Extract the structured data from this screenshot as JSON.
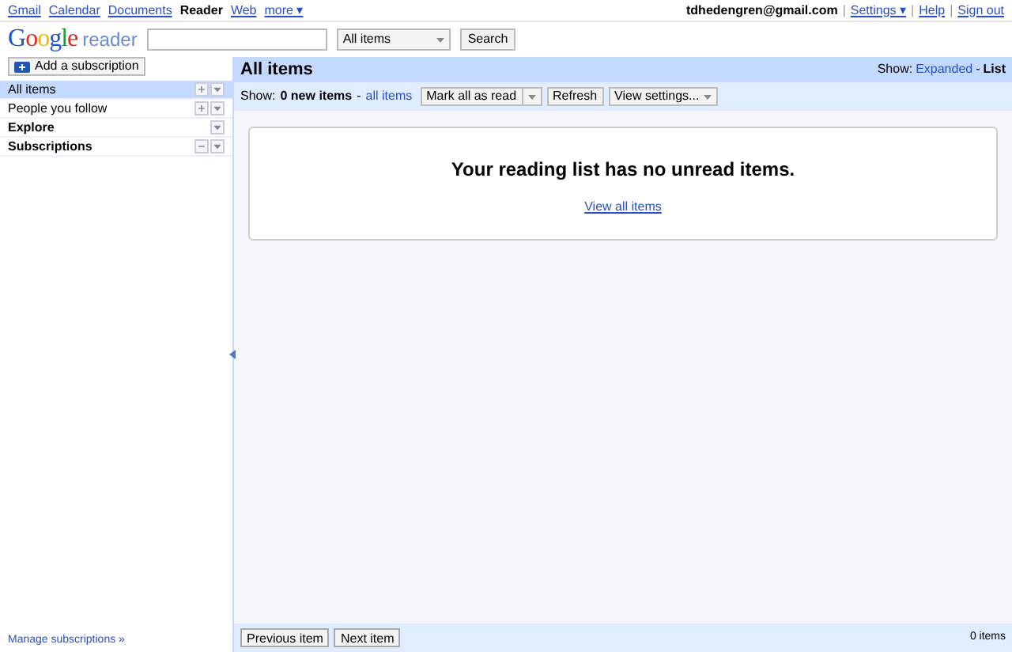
{
  "topnav": {
    "links": [
      {
        "label": "Gmail",
        "selected": false
      },
      {
        "label": "Calendar",
        "selected": false
      },
      {
        "label": "Documents",
        "selected": false
      },
      {
        "label": "Reader",
        "selected": true
      },
      {
        "label": "Web",
        "selected": false
      },
      {
        "label": "more ▾",
        "selected": false
      }
    ],
    "account": "tdhedengren@gmail.com",
    "right_links": [
      {
        "separator": "|",
        "label": "Settings ▾"
      },
      {
        "separator": "|",
        "label": "Help"
      },
      {
        "separator": "|",
        "label": "Sign out"
      }
    ]
  },
  "header": {
    "logo_word": "Google",
    "logo_product": "reader",
    "scope": "All items",
    "search_button": "Search"
  },
  "sidebar": {
    "add_button": "Add a subscription",
    "items": [
      {
        "label": "All items",
        "selected": true,
        "bold": false,
        "icons": [
          {
            "kind": "plus"
          },
          {
            "kind": "menu"
          }
        ]
      },
      {
        "label": "People you follow",
        "selected": false,
        "bold": false,
        "icons": [
          {
            "kind": "plus"
          },
          {
            "kind": "menu"
          }
        ]
      },
      {
        "label": "Explore",
        "selected": false,
        "bold": true,
        "icons": [
          {
            "kind": "menu"
          }
        ]
      },
      {
        "label": "Subscriptions",
        "selected": false,
        "bold": true,
        "icons": [
          {
            "kind": "minus"
          },
          {
            "kind": "menu"
          }
        ]
      }
    ],
    "manage_link": "Manage subscriptions »"
  },
  "main": {
    "title": "All items",
    "view_label": "Show:",
    "views": [
      {
        "label": "Expanded",
        "selected": false
      },
      {
        "separator": "-",
        "label": "List",
        "selected": true
      }
    ],
    "filter_label": "Show:",
    "filter_new": "0 new items",
    "filter_separator": "-",
    "filter_all": "all items",
    "toolbar": [
      {
        "label": "Mark all as read",
        "kind": "split"
      },
      {
        "label": "Refresh",
        "kind": "plain"
      },
      {
        "label": "View settings...",
        "kind": "dropdown"
      }
    ],
    "empty_message": "Your reading list has no unread items.",
    "empty_link": "View all items",
    "footer_buttons": [
      "Previous item",
      "Next item"
    ],
    "count": "0 items"
  }
}
